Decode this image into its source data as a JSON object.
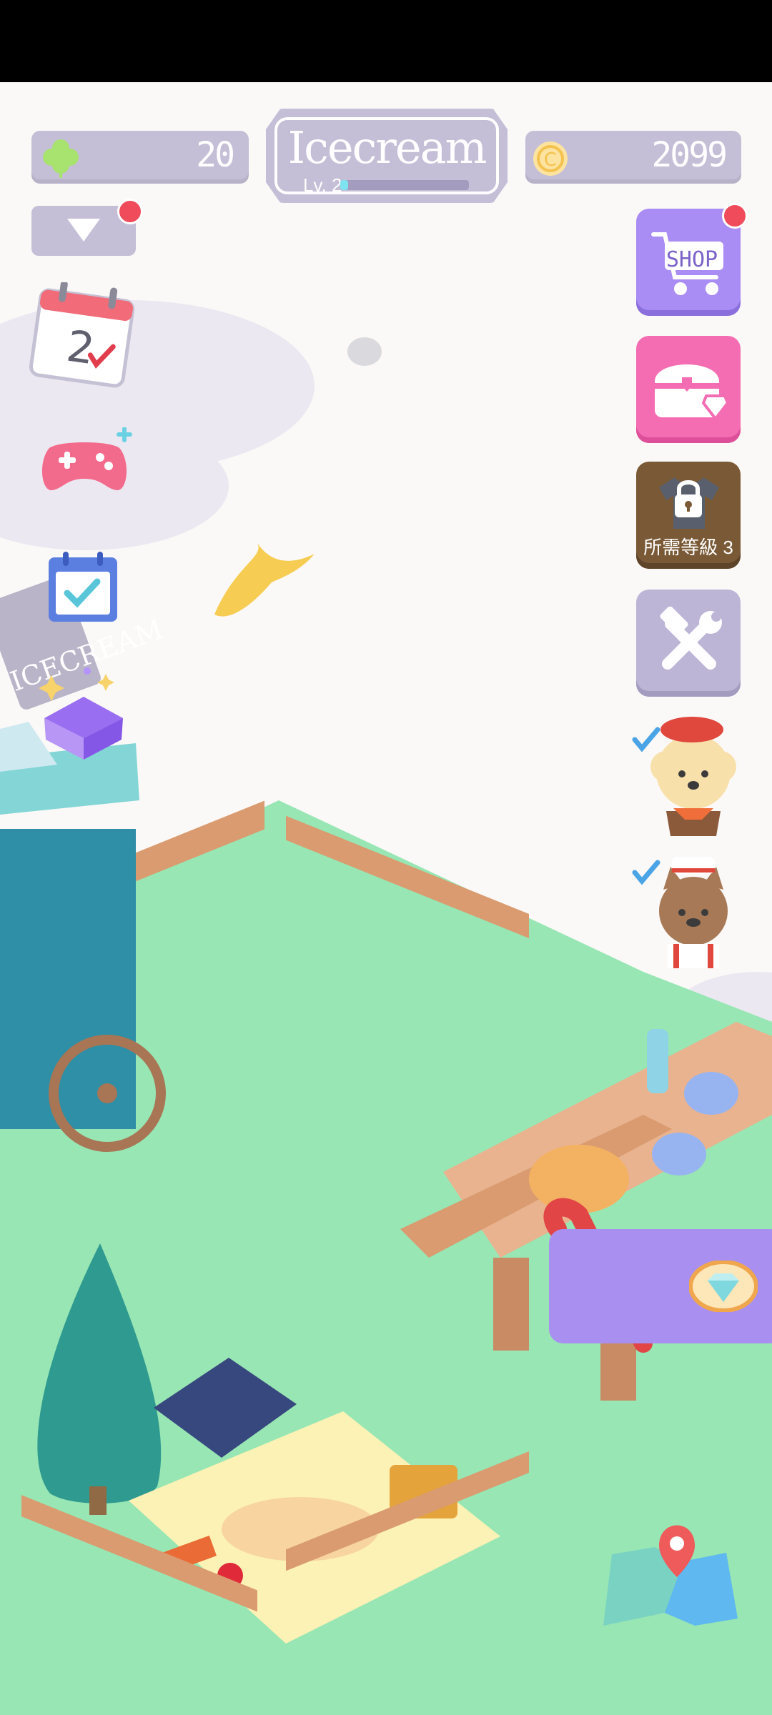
{
  "status_bar": {},
  "hud": {
    "clover": {
      "icon": "clover-icon",
      "value": "20"
    },
    "coins": {
      "icon": "coin-icon",
      "value": "2099"
    },
    "title": {
      "name": "Icecream",
      "level_label": "Lv. 2",
      "level_progress": 0.06
    }
  },
  "left_menu": [
    {
      "icon": "dropdown-arrow-icon",
      "badge": true
    },
    {
      "icon": "calendar-checkin-icon",
      "number": "2"
    },
    {
      "icon": "gamepad-icon"
    },
    {
      "icon": "task-checklist-icon"
    },
    {
      "icon": "gift-box-icon"
    }
  ],
  "right_menu": {
    "shop": {
      "label": "SHOP",
      "badge": true
    },
    "treasure": {
      "icon": "treasure-chest-icon"
    },
    "locked_outfits": {
      "label": "所需等級 3",
      "icon": "lock-icon"
    },
    "tools": {
      "icon": "hammer-wrench-icon"
    },
    "characters": [
      {
        "icon": "poodle-chef-avatar",
        "checked": true
      },
      {
        "icon": "cat-chef-avatar",
        "checked": true
      }
    ]
  },
  "scene": {
    "sign_text": "ICECREAM",
    "items": [
      "banana-peel",
      "rock",
      "ice-cream-cart",
      "fence",
      "picnic-table",
      "candy-cane",
      "sleeping-cat",
      "sleeping-dog",
      "pine-tree",
      "cushion",
      "picnic-basket",
      "book",
      "apple"
    ],
    "gem_reward": {
      "icon": "diamond-icon"
    }
  },
  "map_button": {
    "icon": "map-icon"
  },
  "colors": {
    "grass": "#98e6b4",
    "hud_pill": "#c4bed6",
    "shop_purple": "#a98cf4",
    "treasure_pink": "#f46db3",
    "locked_brown": "#7a5a36",
    "tools_lilac": "#bdb5d6"
  }
}
